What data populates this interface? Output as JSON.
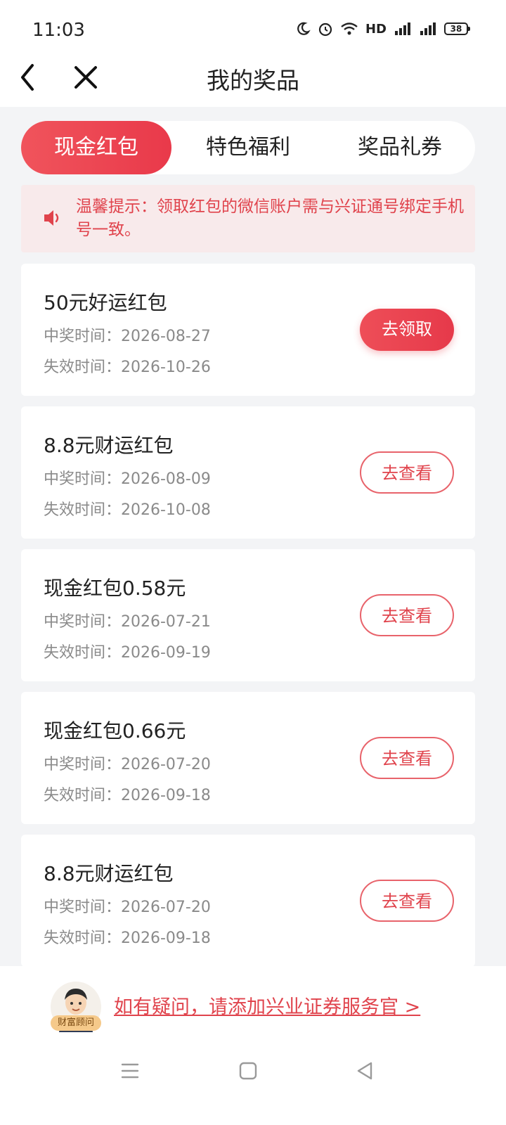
{
  "status_bar": {
    "time": "11:03",
    "network": "HD",
    "battery": "38"
  },
  "nav": {
    "title": "我的奖品"
  },
  "tabs": [
    {
      "label": "现金红包",
      "active": true
    },
    {
      "label": "特色福利",
      "active": false
    },
    {
      "label": "奖品礼券",
      "active": false
    }
  ],
  "notice": {
    "text": "温馨提示：领取红包的微信账户需与兴证通号绑定手机号一致。"
  },
  "prizes": [
    {
      "title": "50元好运红包",
      "won": "中奖时间：2026-08-27",
      "expire": "失效时间：2026-10-26",
      "button": "去领取",
      "style": "filled"
    },
    {
      "title": "8.8元财运红包",
      "won": "中奖时间：2026-08-09",
      "expire": "失效时间：2026-10-08",
      "button": "去查看",
      "style": "outline"
    },
    {
      "title": "现金红包0.58元",
      "won": "中奖时间：2026-07-21",
      "expire": "失效时间：2026-09-19",
      "button": "去查看",
      "style": "outline"
    },
    {
      "title": "现金红包0.66元",
      "won": "中奖时间：2026-07-20",
      "expire": "失效时间：2026-09-18",
      "button": "去查看",
      "style": "outline"
    },
    {
      "title": "8.8元财运红包",
      "won": "中奖时间：2026-07-20",
      "expire": "失效时间：2026-09-18",
      "button": "去查看",
      "style": "outline"
    }
  ],
  "footer": {
    "advisor_badge": "财富顾问",
    "help_link": "如有疑问，请添加兴业证券服务官 >"
  },
  "colors": {
    "accent": "#e9394a",
    "notice_bg": "#f8eaeb",
    "meta_text": "#8a8a8a"
  }
}
